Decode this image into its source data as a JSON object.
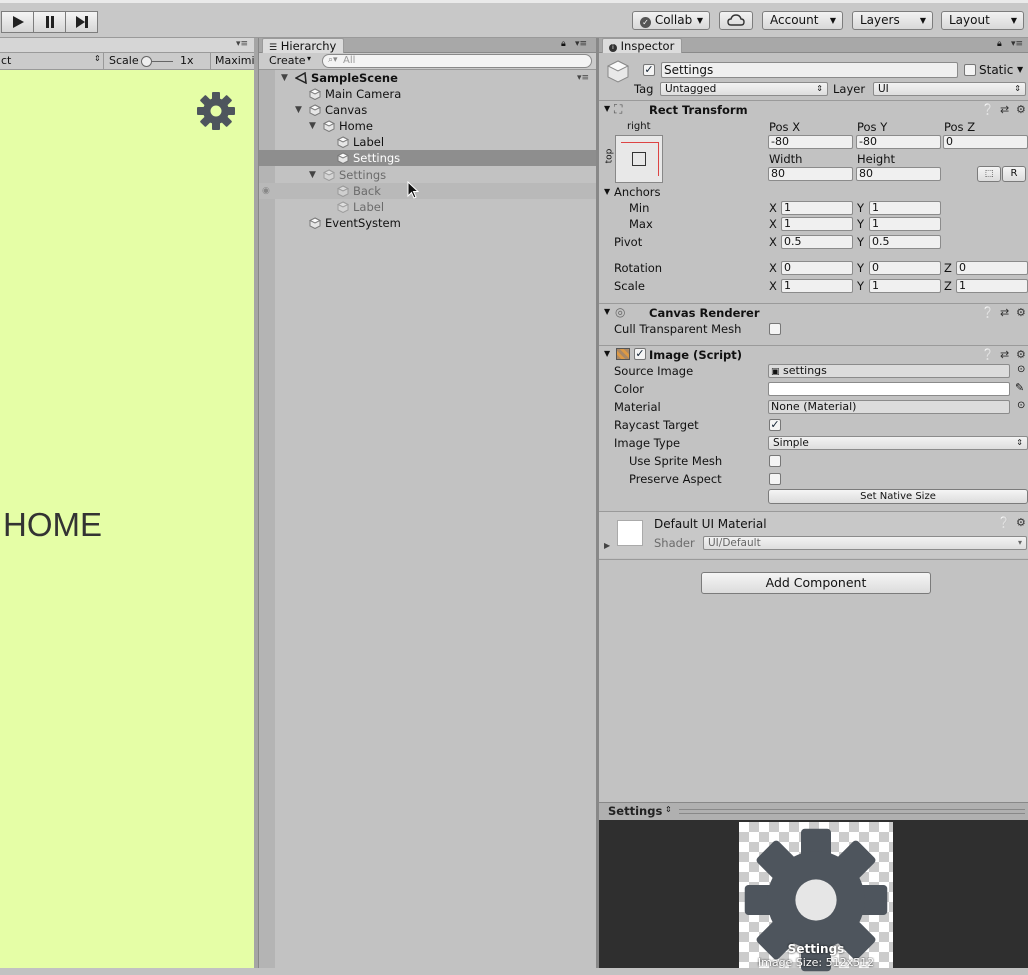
{
  "toolbar": {
    "collab": "Collab",
    "account": "Account",
    "layers": "Layers",
    "layout": "Layout"
  },
  "game": {
    "aspect": "ct",
    "scale_label": "Scale",
    "scale_value": "1x",
    "maximize": "Maximi",
    "home_text": "HOME",
    "colors": {
      "background": "#e5fea6",
      "gear": "#4e555d"
    }
  },
  "hierarchy": {
    "tab": "Hierarchy",
    "create": "Create",
    "search_placeholder": "All",
    "items": [
      {
        "label": "SampleScene",
        "depth": 0,
        "expanded": true,
        "bold": true,
        "scene": true
      },
      {
        "label": "Main Camera",
        "depth": 1
      },
      {
        "label": "Canvas",
        "depth": 1,
        "expanded": true
      },
      {
        "label": "Home",
        "depth": 2,
        "expanded": true
      },
      {
        "label": "Label",
        "depth": 3
      },
      {
        "label": "Settings",
        "depth": 3,
        "selected": true
      },
      {
        "label": "Settings",
        "depth": 2,
        "expanded": true,
        "dim": true
      },
      {
        "label": "Back",
        "depth": 3,
        "dim": true,
        "hover": true
      },
      {
        "label": "Label",
        "depth": 3,
        "dim": true
      },
      {
        "label": "EventSystem",
        "depth": 1
      }
    ]
  },
  "inspector": {
    "tab": "Inspector",
    "object_name": "Settings",
    "static_label": "Static",
    "tag_label": "Tag",
    "tag_value": "Untagged",
    "layer_label": "Layer",
    "layer_value": "UI",
    "rect": {
      "title": "Rect Transform",
      "anchor_h": "right",
      "anchor_v": "top",
      "pos_x_label": "Pos X",
      "pos_y_label": "Pos Y",
      "pos_z_label": "Pos Z",
      "pos_x": "-80",
      "pos_y": "-80",
      "pos_z": "0",
      "width_label": "Width",
      "height_label": "Height",
      "width": "80",
      "height": "80",
      "r_button": "R",
      "anchors_label": "Anchors",
      "min_label": "Min",
      "max_label": "Max",
      "min_x": "1",
      "min_y": "1",
      "max_x": "1",
      "max_y": "1",
      "pivot_label": "Pivot",
      "pivot_x": "0.5",
      "pivot_y": "0.5",
      "rotation_label": "Rotation",
      "rot_x": "0",
      "rot_y": "0",
      "rot_z": "0",
      "scale_label": "Scale",
      "scale_x": "1",
      "scale_y": "1",
      "scale_z": "1",
      "x": "X",
      "y": "Y",
      "z": "Z"
    },
    "canvas_renderer": {
      "title": "Canvas Renderer",
      "cull_label": "Cull Transparent Mesh"
    },
    "image": {
      "title": "Image (Script)",
      "source_label": "Source Image",
      "source_value": "settings",
      "color_label": "Color",
      "material_label": "Material",
      "material_value": "None (Material)",
      "raycast_label": "Raycast Target",
      "type_label": "Image Type",
      "type_value": "Simple",
      "sprite_mesh_label": "Use Sprite Mesh",
      "preserve_label": "Preserve Aspect",
      "native_size": "Set Native Size"
    },
    "material": {
      "title": "Default UI Material",
      "shader_label": "Shader",
      "shader_value": "UI/Default"
    },
    "add_component": "Add Component",
    "preview": {
      "title": "Settings",
      "caption": "Settings",
      "size": "Image Size: 512x512"
    }
  }
}
